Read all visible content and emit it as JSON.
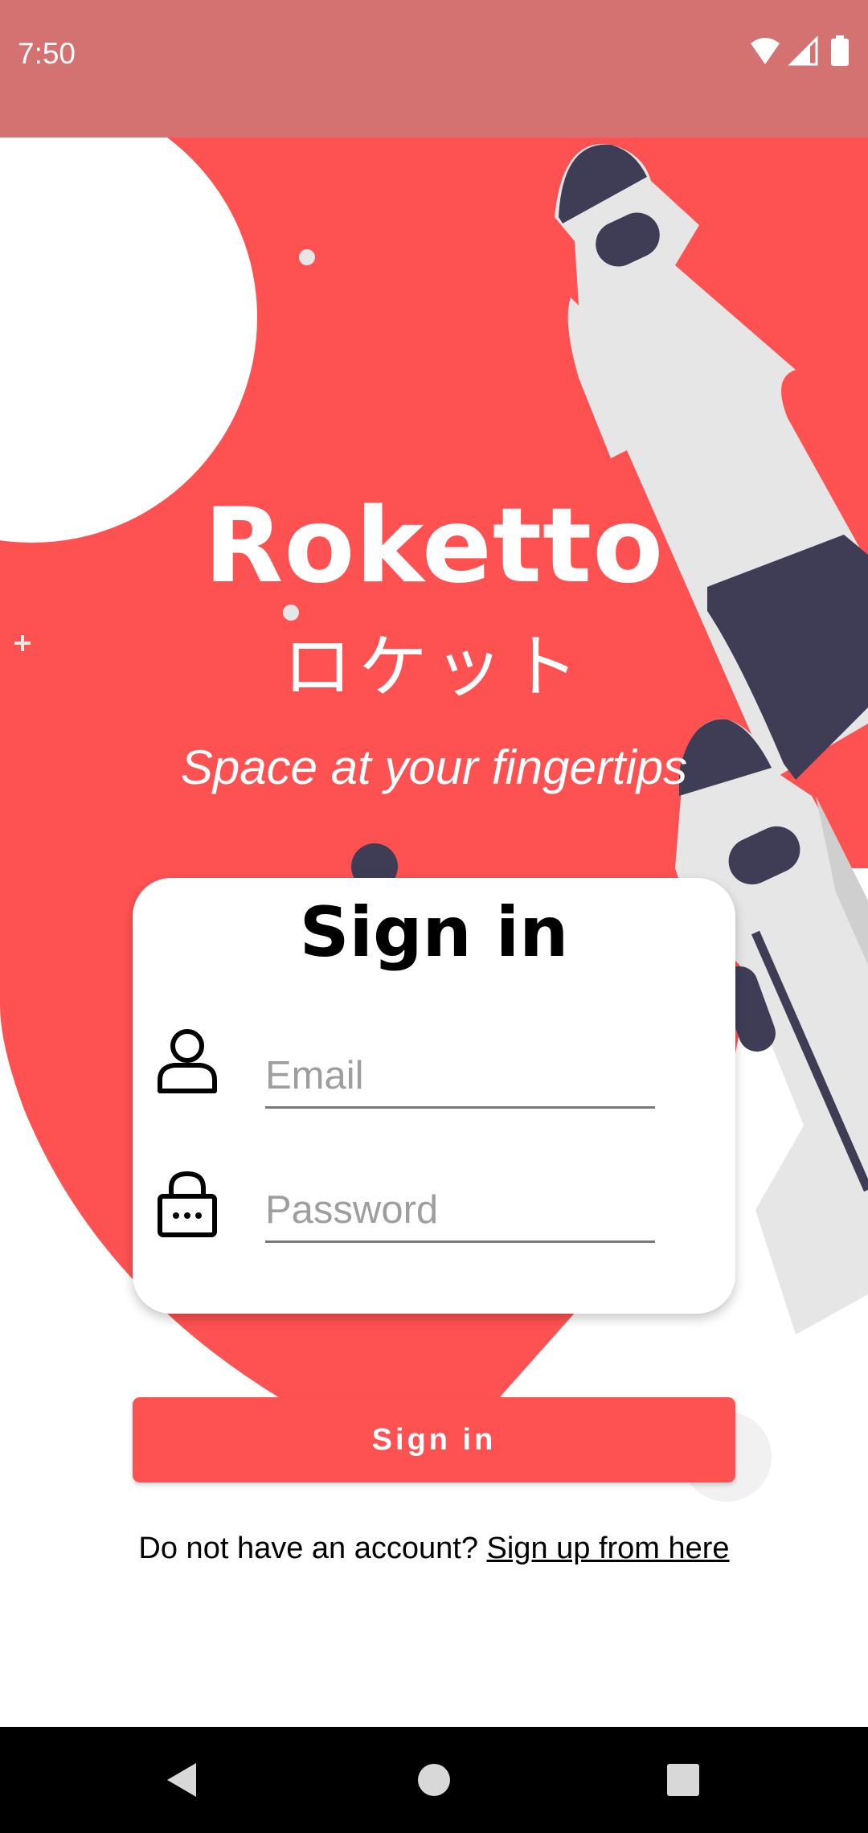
{
  "status_bar": {
    "time": "7:50",
    "icons": [
      "wifi-icon",
      "cell-signal-icon",
      "battery-icon"
    ],
    "background": "#d47171"
  },
  "hero": {
    "title": "Roketto",
    "subtitle_jp": "ロケット",
    "tagline": "Space at your fingertips"
  },
  "card": {
    "title": "Sign in",
    "email": {
      "placeholder": "Email",
      "value": "",
      "icon": "user-icon"
    },
    "password": {
      "placeholder": "Password",
      "value": "",
      "icon": "lock-icon"
    }
  },
  "actions": {
    "sign_in_label": "Sign in",
    "signup_prompt": "Do not have an account?",
    "signup_link": "Sign up from here"
  },
  "nav": {
    "items": [
      "back-icon",
      "home-icon",
      "recents-icon"
    ]
  },
  "colors": {
    "accent": "#fe5252",
    "rocket_dark": "#3f3d56",
    "rocket_light": "#e6e6e6"
  }
}
